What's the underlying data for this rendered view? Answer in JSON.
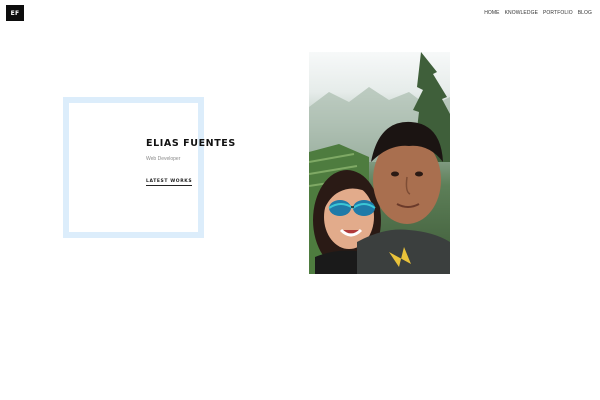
{
  "header": {
    "logo_text": "EF",
    "nav": [
      {
        "label": "HOME"
      },
      {
        "label": "KNOWLEDGE"
      },
      {
        "label": "PORTFOLIO"
      },
      {
        "label": "BLOG"
      }
    ]
  },
  "hero": {
    "name": "ELIAS FUENTES",
    "role": "Web Developer",
    "cta_label": "LATEST WORKS"
  },
  "colors": {
    "frame_border": "#dcedfb",
    "logo_background": "#0d0d0d",
    "text_primary": "#111111",
    "text_muted": "#8a8a8a"
  }
}
